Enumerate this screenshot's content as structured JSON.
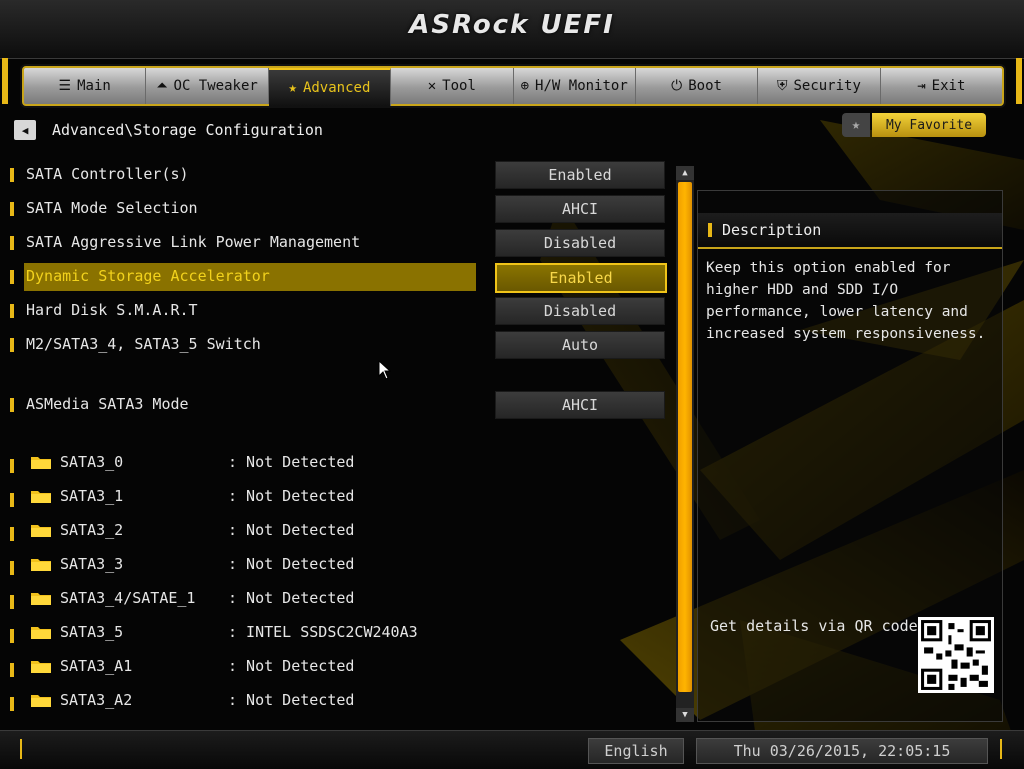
{
  "brand": {
    "logo_text": "ASRock UEFI"
  },
  "tabs": [
    {
      "label": "Main",
      "icon": "list-icon",
      "active": false
    },
    {
      "label": "OC Tweaker",
      "icon": "rocket-icon",
      "active": false
    },
    {
      "label": "Advanced",
      "icon": "star-icon",
      "active": true
    },
    {
      "label": "Tool",
      "icon": "tools-icon",
      "active": false
    },
    {
      "label": "H/W Monitor",
      "icon": "globe-icon",
      "active": false
    },
    {
      "label": "Boot",
      "icon": "power-icon",
      "active": false
    },
    {
      "label": "Security",
      "icon": "shield-icon",
      "active": false
    },
    {
      "label": "Exit",
      "icon": "exit-icon",
      "active": false
    }
  ],
  "breadcrumb": "Advanced\\Storage Configuration",
  "favorite": {
    "label": "My Favorite"
  },
  "settings": [
    {
      "label": "SATA Controller(s)",
      "value": "Enabled"
    },
    {
      "label": "SATA Mode Selection",
      "value": "AHCI"
    },
    {
      "label": "SATA Aggressive Link Power Management",
      "value": "Disabled"
    },
    {
      "label": "Dynamic Storage Accelerator",
      "value": "Enabled",
      "selected": true
    },
    {
      "label": "Hard Disk S.M.A.R.T",
      "value": "Disabled"
    },
    {
      "label": "M2/SATA3_4, SATA3_5  Switch",
      "value": "Auto"
    },
    {
      "label": "ASMedia SATA3 Mode",
      "value": "AHCI"
    }
  ],
  "storage_ports": [
    {
      "name": "SATA3_0",
      "value": ": Not Detected"
    },
    {
      "name": "SATA3_1",
      "value": ": Not Detected"
    },
    {
      "name": "SATA3_2",
      "value": ": Not Detected"
    },
    {
      "name": "SATA3_3",
      "value": ": Not Detected"
    },
    {
      "name": "SATA3_4/SATAE_1",
      "value": ": Not Detected"
    },
    {
      "name": "SATA3_5",
      "value": ": INTEL SSDSC2CW240A3"
    },
    {
      "name": "SATA3_A1",
      "value": ": Not Detected"
    },
    {
      "name": "SATA3_A2",
      "value": ": Not Detected"
    }
  ],
  "description": {
    "title": "Description",
    "text": "Keep this option enabled for higher HDD and SDD I/O performance, lower latency and increased system responsiveness.",
    "qr_label": "Get details via QR code"
  },
  "footer": {
    "language": "English",
    "datetime": "Thu 03/26/2015, 22:05:15"
  },
  "colors": {
    "accent": "#f0c419",
    "selected_row": "#8a7200",
    "scroll_thumb": "#ffb400",
    "background": "#050505"
  }
}
